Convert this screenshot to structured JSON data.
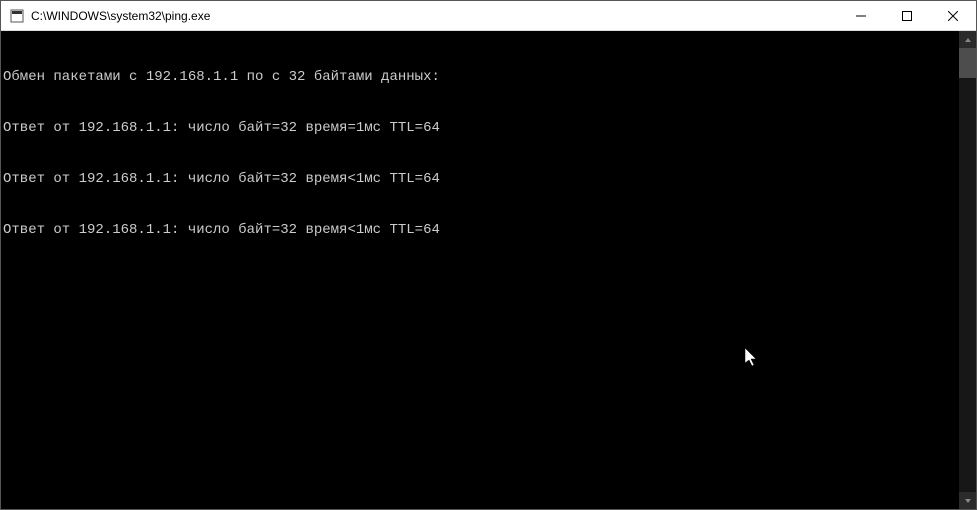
{
  "window": {
    "title": "C:\\WINDOWS\\system32\\ping.exe"
  },
  "console": {
    "lines": [
      "Обмен пакетами с 192.168.1.1 по с 32 байтами данных:",
      "Ответ от 192.168.1.1: число байт=32 время=1мс TTL=64",
      "Ответ от 192.168.1.1: число байт=32 время<1мс TTL=64",
      "Ответ от 192.168.1.1: число байт=32 время<1мс TTL=64"
    ]
  }
}
